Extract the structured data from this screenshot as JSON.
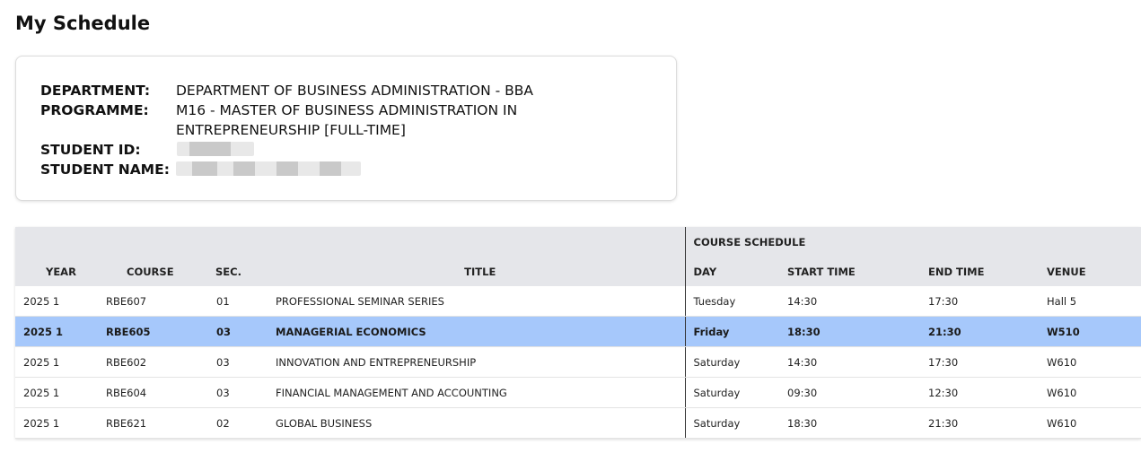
{
  "page": {
    "title": "My Schedule"
  },
  "student_info": {
    "department_label": "DEPARTMENT:",
    "department_value": "DEPARTMENT OF BUSINESS ADMINISTRATION - BBA",
    "programme_label": "PROGRAMME:",
    "programme_value": "M16 - MASTER OF BUSINESS ADMINISTRATION IN ENTREPRENEURSHIP [FULL-TIME]",
    "student_id_label": "STUDENT ID:",
    "student_name_label": "STUDENT NAME:"
  },
  "table": {
    "group_header": "COURSE SCHEDULE",
    "columns": {
      "year": "YEAR",
      "course": "COURSE",
      "sec": "SEC.",
      "title": "TITLE",
      "day": "DAY",
      "start": "START TIME",
      "end": "END TIME",
      "venue": "VENUE"
    },
    "highlight_color": "#a6c8fb",
    "rows": [
      {
        "year": "2025 1",
        "course": "RBE607",
        "sec": "01",
        "title": "PROFESSIONAL SEMINAR SERIES",
        "day": "Tuesday",
        "start": "14:30",
        "end": "17:30",
        "venue": "Hall 5"
      },
      {
        "year": "2025 1",
        "course": "RBE605",
        "sec": "03",
        "title": "MANAGERIAL ECONOMICS",
        "day": "Friday",
        "start": "18:30",
        "end": "21:30",
        "venue": "W510"
      },
      {
        "year": "2025 1",
        "course": "RBE602",
        "sec": "03",
        "title": "INNOVATION AND ENTREPRENEURSHIP",
        "day": "Saturday",
        "start": "14:30",
        "end": "17:30",
        "venue": "W610"
      },
      {
        "year": "2025 1",
        "course": "RBE604",
        "sec": "03",
        "title": "FINANCIAL MANAGEMENT AND ACCOUNTING",
        "day": "Saturday",
        "start": "09:30",
        "end": "12:30",
        "venue": "W610"
      },
      {
        "year": "2025 1",
        "course": "RBE621",
        "sec": "02",
        "title": "GLOBAL BUSINESS",
        "day": "Saturday",
        "start": "18:30",
        "end": "21:30",
        "venue": "W610"
      }
    ]
  }
}
